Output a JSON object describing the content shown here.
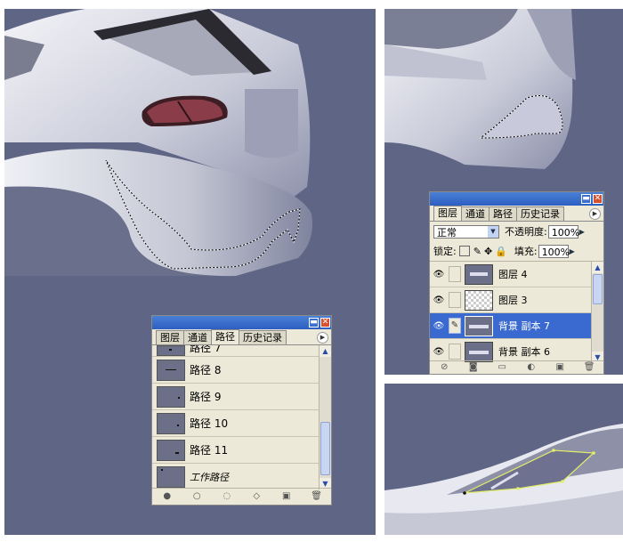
{
  "paths_panel": {
    "tabs": [
      "图层",
      "通道",
      "路径",
      "历史记录"
    ],
    "active_tab": "路径",
    "items": [
      {
        "label": "路径 7",
        "partial": true
      },
      {
        "label": "路径 8"
      },
      {
        "label": "路径 9"
      },
      {
        "label": "路径 10"
      },
      {
        "label": "路径 11"
      },
      {
        "label": "工作路径",
        "italic": true
      }
    ],
    "bottom_icons": [
      "fill-path-icon",
      "stroke-path-icon",
      "load-selection-icon",
      "make-path-icon",
      "new-path-icon",
      "delete-icon"
    ]
  },
  "layers_panel": {
    "tabs": [
      "图层",
      "通道",
      "路径",
      "历史记录"
    ],
    "active_tab": "图层",
    "blend_mode": "正常",
    "opacity_label": "不透明度:",
    "opacity_value": "100%",
    "lock_label": "锁定:",
    "fill_label": "填充:",
    "fill_value": "100%",
    "layers": [
      {
        "name": "图层 4",
        "thumb": "car-thumb",
        "selected": false
      },
      {
        "name": "图层 3",
        "thumb": "transparent",
        "selected": false
      },
      {
        "name": "背景 副本 7",
        "thumb": "car-thumb",
        "selected": true
      },
      {
        "name": "背景 副本 6",
        "thumb": "car-thumb",
        "selected": false
      }
    ],
    "bottom_icons": [
      "link-icon",
      "layer-style-icon",
      "mask-icon",
      "folder-icon",
      "adjustment-icon",
      "new-layer-icon",
      "delete-icon"
    ]
  },
  "colors": {
    "background": "#5f6585",
    "car_body": "#d9dbe6",
    "panel_bg": "#ece9d8",
    "selection": "#3a6ad0",
    "titlebar": "#2c5fc1"
  }
}
